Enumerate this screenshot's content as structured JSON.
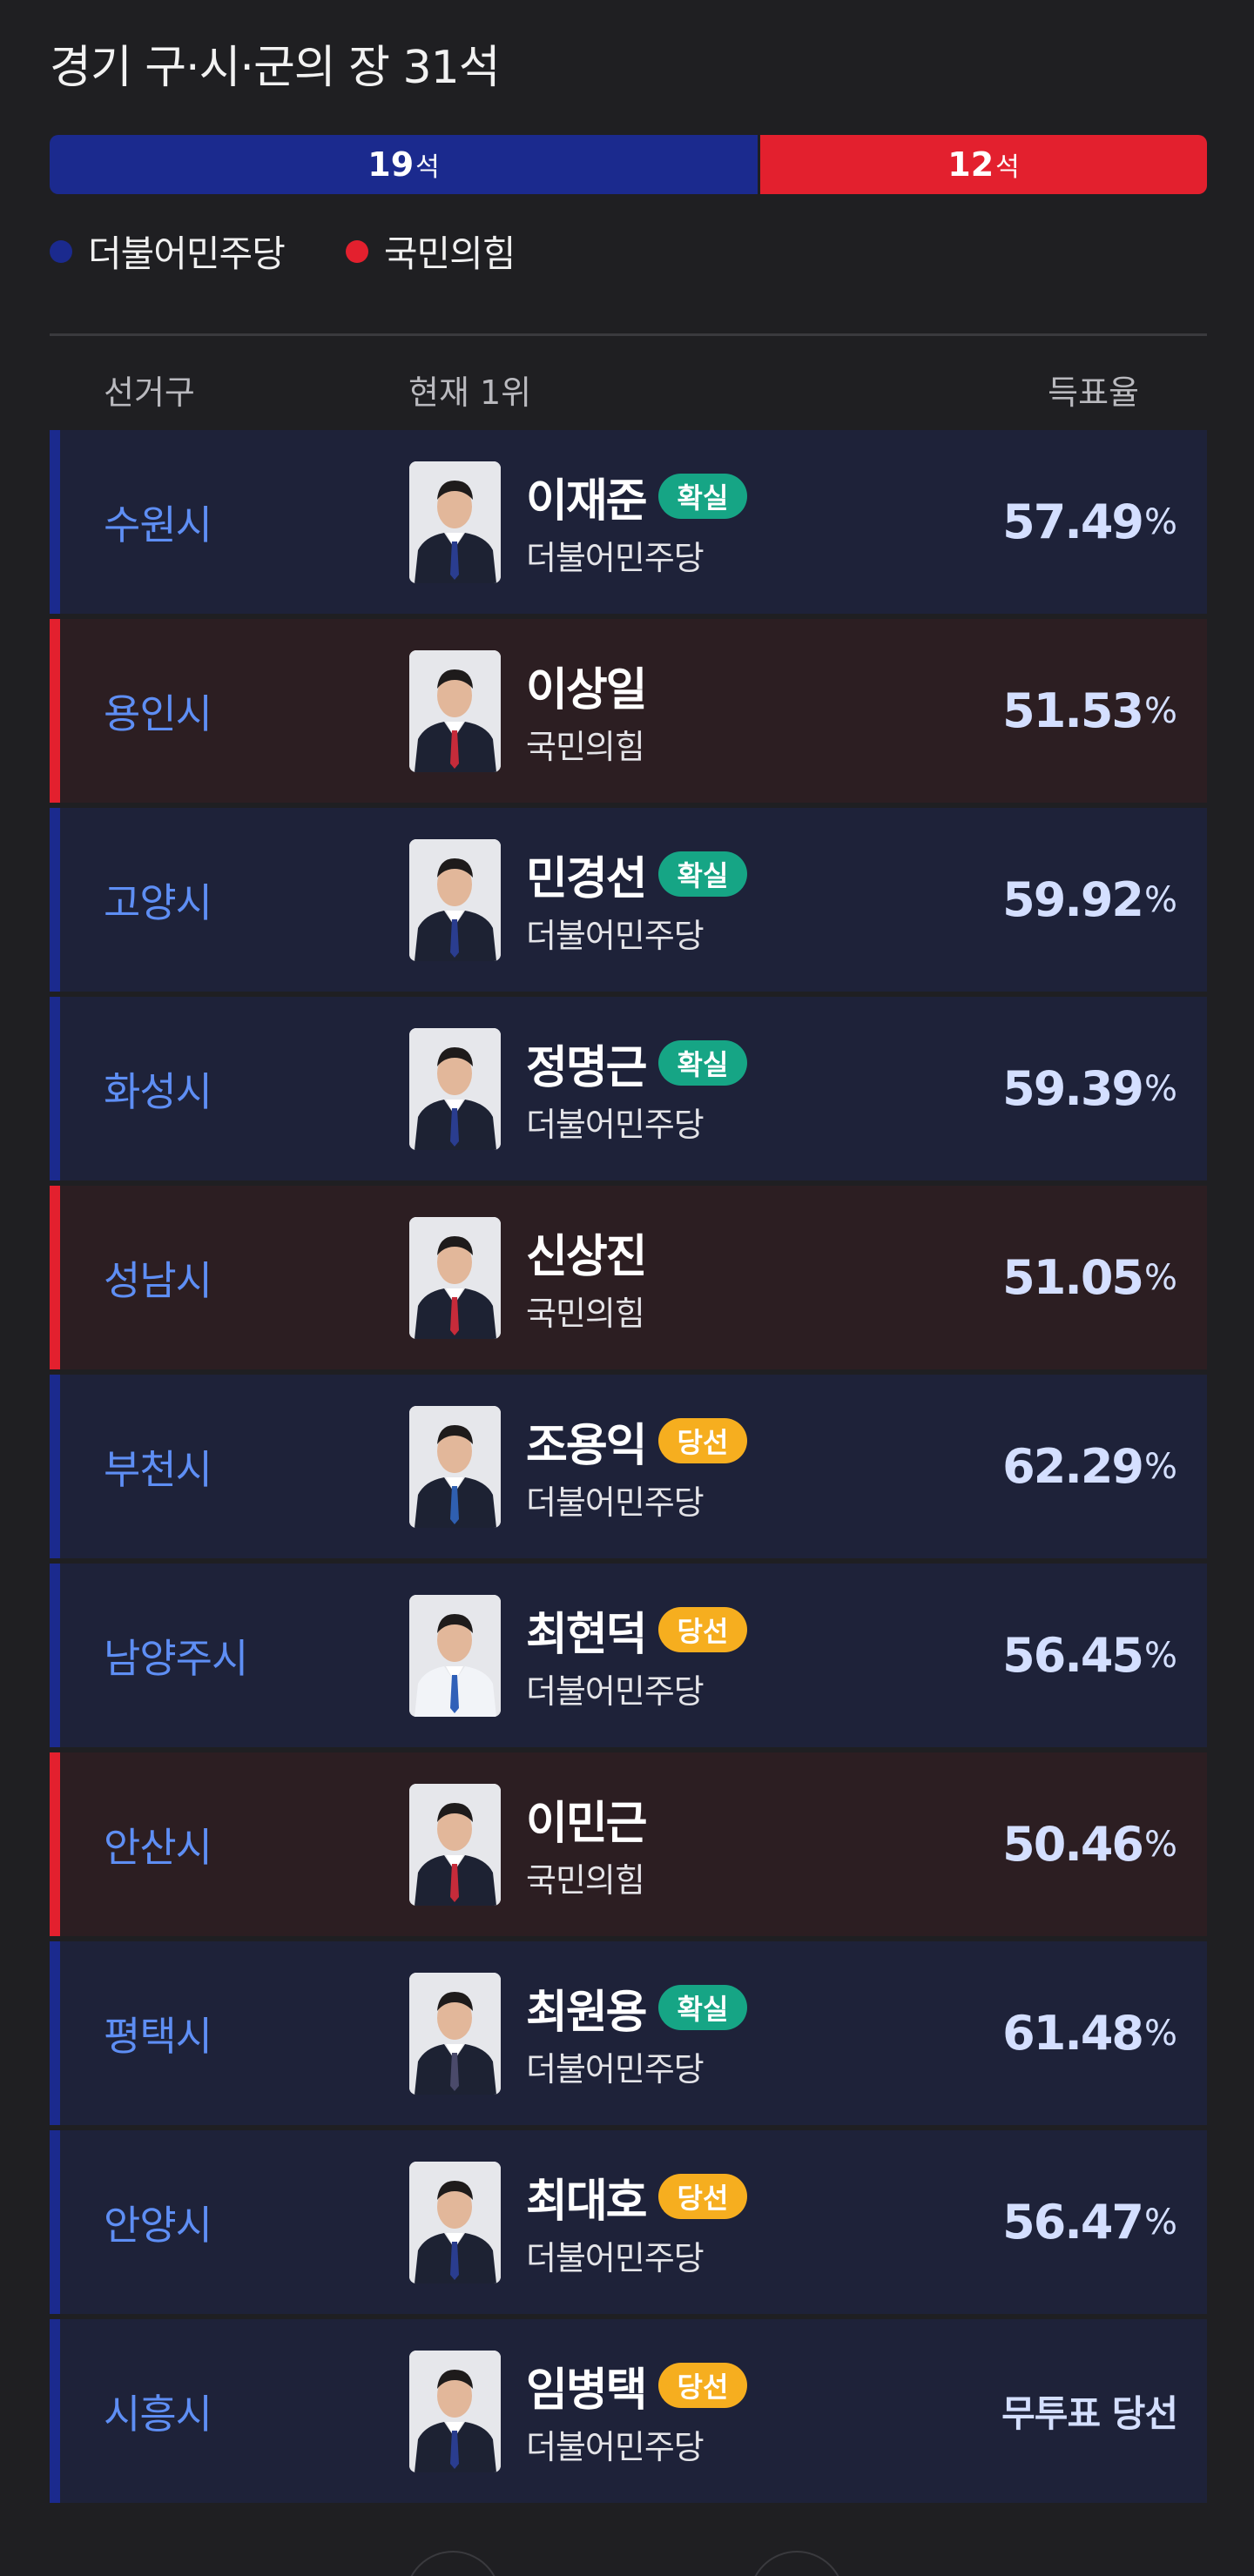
{
  "title": "경기 구·시·군의 장 31석",
  "seats": {
    "dem": {
      "count": "19",
      "unit": "석",
      "color": "#1b2a8e",
      "share": 0.6129
    },
    "ppp": {
      "count": "12",
      "unit": "석",
      "color": "#e3202e",
      "share": 0.3871
    }
  },
  "legend": [
    {
      "label": "더불어민주당",
      "color": "#1b2a8e"
    },
    {
      "label": "국민의힘",
      "color": "#e3202e"
    }
  ],
  "headers": {
    "district": "선거구",
    "leader": "현재 1위",
    "rate": "득표율"
  },
  "rows": [
    {
      "district": "수원시",
      "name": "이재준",
      "badge": "확실",
      "badge_type": "sure",
      "party": "더불어민주당",
      "party_key": "dem",
      "rate": "57.49",
      "pct": "%"
    },
    {
      "district": "용인시",
      "name": "이상일",
      "badge": "",
      "badge_type": "",
      "party": "국민의힘",
      "party_key": "ppp",
      "rate": "51.53",
      "pct": "%"
    },
    {
      "district": "고양시",
      "name": "민경선",
      "badge": "확실",
      "badge_type": "sure",
      "party": "더불어민주당",
      "party_key": "dem",
      "rate": "59.92",
      "pct": "%"
    },
    {
      "district": "화성시",
      "name": "정명근",
      "badge": "확실",
      "badge_type": "sure",
      "party": "더불어민주당",
      "party_key": "dem",
      "rate": "59.39",
      "pct": "%"
    },
    {
      "district": "성남시",
      "name": "신상진",
      "badge": "",
      "badge_type": "",
      "party": "국민의힘",
      "party_key": "ppp",
      "rate": "51.05",
      "pct": "%"
    },
    {
      "district": "부천시",
      "name": "조용익",
      "badge": "당선",
      "badge_type": "won",
      "party": "더불어민주당",
      "party_key": "dem",
      "rate": "62.29",
      "pct": "%"
    },
    {
      "district": "남양주시",
      "name": "최현덕",
      "badge": "당선",
      "badge_type": "won",
      "party": "더불어민주당",
      "party_key": "dem",
      "rate": "56.45",
      "pct": "%"
    },
    {
      "district": "안산시",
      "name": "이민근",
      "badge": "",
      "badge_type": "",
      "party": "국민의힘",
      "party_key": "ppp",
      "rate": "50.46",
      "pct": "%"
    },
    {
      "district": "평택시",
      "name": "최원용",
      "badge": "확실",
      "badge_type": "sure",
      "party": "더불어민주당",
      "party_key": "dem",
      "rate": "61.48",
      "pct": "%"
    },
    {
      "district": "안양시",
      "name": "최대호",
      "badge": "당선",
      "badge_type": "won",
      "party": "더불어민주당",
      "party_key": "dem",
      "rate": "56.47",
      "pct": "%"
    },
    {
      "district": "시흥시",
      "name": "임병택",
      "badge": "당선",
      "badge_type": "won",
      "party": "더불어민주당",
      "party_key": "dem",
      "rate": "",
      "pct": "",
      "note": "무투표 당선"
    }
  ]
}
